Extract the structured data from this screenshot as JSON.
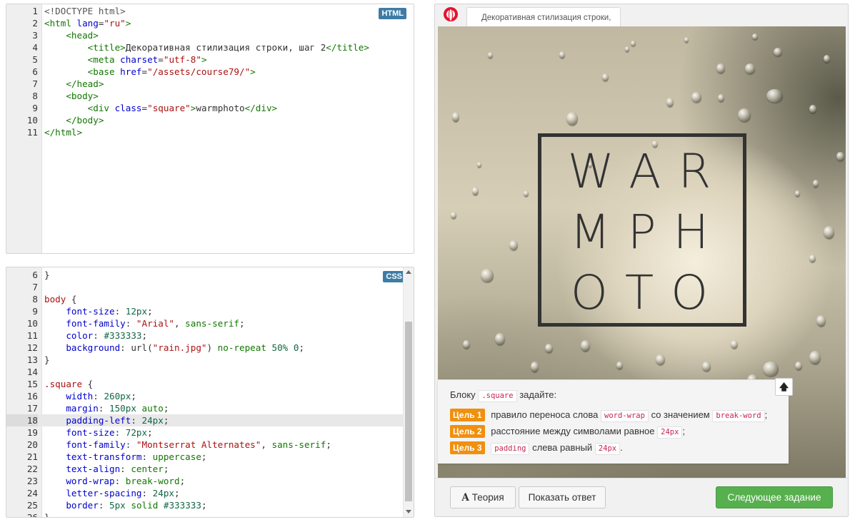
{
  "html_editor": {
    "badge": "HTML",
    "lines": [
      {
        "num": "1",
        "parts": [
          {
            "c": "m",
            "t": "<!DOCTYPE html>"
          }
        ]
      },
      {
        "num": "2",
        "parts": [
          {
            "c": "t",
            "t": "<html"
          },
          {
            "c": "a",
            "t": " lang"
          },
          {
            "c": "",
            "t": "="
          },
          {
            "c": "s",
            "t": "\"ru\""
          },
          {
            "c": "t",
            "t": ">"
          }
        ]
      },
      {
        "num": "3",
        "parts": [
          {
            "c": "",
            "t": "    "
          },
          {
            "c": "t",
            "t": "<head>"
          }
        ]
      },
      {
        "num": "4",
        "parts": [
          {
            "c": "",
            "t": "        "
          },
          {
            "c": "t",
            "t": "<title>"
          },
          {
            "c": "",
            "t": "Декоративная стилизация строки, шаг 2"
          },
          {
            "c": "t",
            "t": "</title>"
          }
        ]
      },
      {
        "num": "5",
        "parts": [
          {
            "c": "",
            "t": "        "
          },
          {
            "c": "t",
            "t": "<meta"
          },
          {
            "c": "a",
            "t": " charset"
          },
          {
            "c": "",
            "t": "="
          },
          {
            "c": "s",
            "t": "\"utf-8\""
          },
          {
            "c": "t",
            "t": ">"
          }
        ]
      },
      {
        "num": "6",
        "parts": [
          {
            "c": "",
            "t": "        "
          },
          {
            "c": "t",
            "t": "<base"
          },
          {
            "c": "a",
            "t": " href"
          },
          {
            "c": "",
            "t": "="
          },
          {
            "c": "s",
            "t": "\"/assets/course79/\""
          },
          {
            "c": "t",
            "t": ">"
          }
        ]
      },
      {
        "num": "7",
        "parts": [
          {
            "c": "",
            "t": "    "
          },
          {
            "c": "t",
            "t": "</head>"
          }
        ]
      },
      {
        "num": "8",
        "parts": [
          {
            "c": "",
            "t": "    "
          },
          {
            "c": "t",
            "t": "<body>"
          }
        ]
      },
      {
        "num": "9",
        "parts": [
          {
            "c": "",
            "t": "        "
          },
          {
            "c": "t",
            "t": "<div"
          },
          {
            "c": "a",
            "t": " class"
          },
          {
            "c": "",
            "t": "="
          },
          {
            "c": "s",
            "t": "\"square\""
          },
          {
            "c": "t",
            "t": ">"
          },
          {
            "c": "",
            "t": "warmphoto"
          },
          {
            "c": "t",
            "t": "</div>"
          }
        ]
      },
      {
        "num": "10",
        "parts": [
          {
            "c": "",
            "t": "    "
          },
          {
            "c": "t",
            "t": "</body>"
          }
        ]
      },
      {
        "num": "11",
        "parts": [
          {
            "c": "t",
            "t": "</html>"
          }
        ]
      }
    ]
  },
  "css_editor": {
    "badge": "CSS",
    "lines": [
      {
        "num": "6",
        "parts": [
          {
            "c": "",
            "t": "}"
          }
        ]
      },
      {
        "num": "7",
        "parts": []
      },
      {
        "num": "8",
        "parts": [
          {
            "c": "kw",
            "t": "body"
          },
          {
            "c": "",
            "t": " {"
          }
        ]
      },
      {
        "num": "9",
        "parts": [
          {
            "c": "",
            "t": "    "
          },
          {
            "c": "p",
            "t": "font-size"
          },
          {
            "c": "",
            "t": ": "
          },
          {
            "c": "n",
            "t": "12px"
          },
          {
            "c": "",
            "t": ";"
          }
        ]
      },
      {
        "num": "10",
        "parts": [
          {
            "c": "",
            "t": "    "
          },
          {
            "c": "p",
            "t": "font-family"
          },
          {
            "c": "",
            "t": ": "
          },
          {
            "c": "str",
            "t": "\"Arial\""
          },
          {
            "c": "",
            "t": ", "
          },
          {
            "c": "v",
            "t": "sans-serif"
          },
          {
            "c": "",
            "t": ";"
          }
        ]
      },
      {
        "num": "11",
        "parts": [
          {
            "c": "",
            "t": "    "
          },
          {
            "c": "p",
            "t": "color"
          },
          {
            "c": "",
            "t": ": "
          },
          {
            "c": "n",
            "t": "#333333"
          },
          {
            "c": "",
            "t": ";"
          }
        ]
      },
      {
        "num": "12",
        "parts": [
          {
            "c": "",
            "t": "    "
          },
          {
            "c": "p",
            "t": "background"
          },
          {
            "c": "",
            "t": ": url("
          },
          {
            "c": "str",
            "t": "\"rain.jpg\""
          },
          {
            "c": "",
            "t": ") "
          },
          {
            "c": "v",
            "t": "no-repeat"
          },
          {
            "c": "",
            "t": " "
          },
          {
            "c": "n",
            "t": "50%"
          },
          {
            "c": "",
            "t": " "
          },
          {
            "c": "n",
            "t": "0"
          },
          {
            "c": "",
            "t": ";"
          }
        ]
      },
      {
        "num": "13",
        "parts": [
          {
            "c": "",
            "t": "}"
          }
        ]
      },
      {
        "num": "14",
        "parts": []
      },
      {
        "num": "15",
        "parts": [
          {
            "c": "kw",
            "t": ".square"
          },
          {
            "c": "",
            "t": " {"
          }
        ]
      },
      {
        "num": "16",
        "parts": [
          {
            "c": "",
            "t": "    "
          },
          {
            "c": "p",
            "t": "width"
          },
          {
            "c": "",
            "t": ": "
          },
          {
            "c": "n",
            "t": "260px"
          },
          {
            "c": "",
            "t": ";"
          }
        ]
      },
      {
        "num": "17",
        "parts": [
          {
            "c": "",
            "t": "    "
          },
          {
            "c": "p",
            "t": "margin"
          },
          {
            "c": "",
            "t": ": "
          },
          {
            "c": "n",
            "t": "150px"
          },
          {
            "c": "",
            "t": " "
          },
          {
            "c": "v",
            "t": "auto"
          },
          {
            "c": "",
            "t": ";"
          }
        ]
      },
      {
        "num": "18",
        "active": true,
        "parts": [
          {
            "c": "",
            "t": "    "
          },
          {
            "c": "p",
            "t": "padding-left"
          },
          {
            "c": "",
            "t": ": "
          },
          {
            "c": "n",
            "t": "24px"
          },
          {
            "c": "",
            "t": ";"
          }
        ]
      },
      {
        "num": "19",
        "parts": [
          {
            "c": "",
            "t": "    "
          },
          {
            "c": "p",
            "t": "font-size"
          },
          {
            "c": "",
            "t": ": "
          },
          {
            "c": "n",
            "t": "72px"
          },
          {
            "c": "",
            "t": ";"
          }
        ]
      },
      {
        "num": "20",
        "parts": [
          {
            "c": "",
            "t": "    "
          },
          {
            "c": "p",
            "t": "font-family"
          },
          {
            "c": "",
            "t": ": "
          },
          {
            "c": "str",
            "t": "\"Montserrat Alternates\""
          },
          {
            "c": "",
            "t": ", "
          },
          {
            "c": "v",
            "t": "sans-serif"
          },
          {
            "c": "",
            "t": ";"
          }
        ]
      },
      {
        "num": "21",
        "parts": [
          {
            "c": "",
            "t": "    "
          },
          {
            "c": "p",
            "t": "text-transform"
          },
          {
            "c": "",
            "t": ": "
          },
          {
            "c": "v",
            "t": "uppercase"
          },
          {
            "c": "",
            "t": ";"
          }
        ]
      },
      {
        "num": "22",
        "parts": [
          {
            "c": "",
            "t": "    "
          },
          {
            "c": "p",
            "t": "text-align"
          },
          {
            "c": "",
            "t": ": "
          },
          {
            "c": "v",
            "t": "center"
          },
          {
            "c": "",
            "t": ";"
          }
        ]
      },
      {
        "num": "23",
        "parts": [
          {
            "c": "",
            "t": "    "
          },
          {
            "c": "p",
            "t": "word-wrap"
          },
          {
            "c": "",
            "t": ": "
          },
          {
            "c": "v",
            "t": "break-word"
          },
          {
            "c": "",
            "t": ";"
          }
        ]
      },
      {
        "num": "24",
        "parts": [
          {
            "c": "",
            "t": "    "
          },
          {
            "c": "p",
            "t": "letter-spacing"
          },
          {
            "c": "",
            "t": ": "
          },
          {
            "c": "n",
            "t": "24px"
          },
          {
            "c": "",
            "t": ";"
          }
        ]
      },
      {
        "num": "25",
        "parts": [
          {
            "c": "",
            "t": "    "
          },
          {
            "c": "p",
            "t": "border"
          },
          {
            "c": "",
            "t": ": "
          },
          {
            "c": "n",
            "t": "5px"
          },
          {
            "c": "",
            "t": " "
          },
          {
            "c": "v",
            "t": "solid"
          },
          {
            "c": "",
            "t": " "
          },
          {
            "c": "n",
            "t": "#333333"
          },
          {
            "c": "",
            "t": ";"
          }
        ]
      },
      {
        "num": "26",
        "parts": [
          {
            "c": "",
            "t": "}"
          }
        ]
      }
    ]
  },
  "preview": {
    "tab_title": "Декоративная стилизация строки,",
    "square_lines": [
      "WAR",
      "MPH",
      "OTO"
    ],
    "task": {
      "intro_before": "Блоку",
      "intro_code": ".square",
      "intro_after": "задайте:",
      "goals": [
        {
          "badge": "Цель 1",
          "text_before": "правило переноса слова",
          "code1": "word-wrap",
          "text_mid": "со значением",
          "code2": "break-word",
          "text_after": ";"
        },
        {
          "badge": "Цель 2",
          "text_before": "расстояние между символами равное",
          "code1": "24px",
          "text_mid": "",
          "code2": "",
          "text_after": ";"
        },
        {
          "badge": "Цель 3",
          "text_before": "",
          "code1": "padding",
          "text_mid": "слева равный",
          "code2": "24px",
          "text_after": "."
        }
      ],
      "collapse_glyph": "🡅"
    },
    "buttons": {
      "theory_glyph": "A",
      "theory": "Теория",
      "answer": "Показать ответ",
      "next": "Следующее задание"
    }
  },
  "colors": {
    "badge": "#3e7ca6",
    "goal_badge": "#f0900e",
    "next_button": "#56b04d",
    "opera_red": "#e8112d"
  }
}
